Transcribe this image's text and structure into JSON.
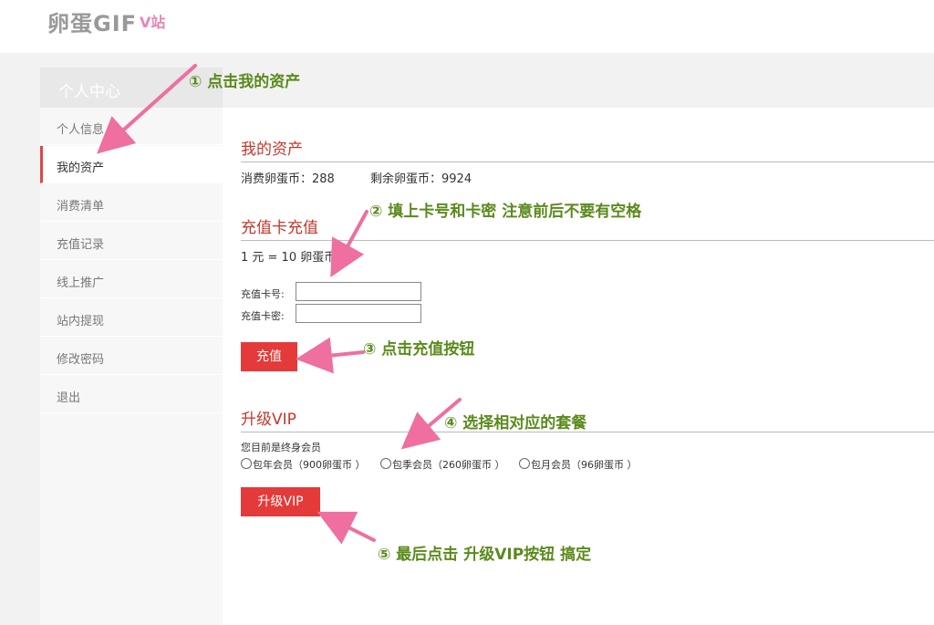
{
  "header": {
    "logo": "卵蛋GIF",
    "logo_sub": "V站"
  },
  "sidebar": {
    "title": "个人中心",
    "items": [
      {
        "label": "个人信息"
      },
      {
        "label": "我的资产"
      },
      {
        "label": "消费清单"
      },
      {
        "label": "充值记录"
      },
      {
        "label": "线上推广"
      },
      {
        "label": "站内提现"
      },
      {
        "label": "修改密码"
      },
      {
        "label": "退出"
      }
    ],
    "active_index": 1
  },
  "assets": {
    "title": "我的资产",
    "spent": "消费卵蛋币：288",
    "remaining": "剩余卵蛋币：9924"
  },
  "recharge": {
    "title": "充值卡充值",
    "rate": "1 元 = 10 卵蛋币",
    "card_no_label": "充值卡号:",
    "card_pwd_label": "充值卡密:",
    "card_no_value": "",
    "card_pwd_value": "",
    "button": "充值"
  },
  "vip": {
    "title": "升级VIP",
    "status": "您目前是终身会员",
    "options": [
      {
        "label": "包年会员（900卵蛋币 ）"
      },
      {
        "label": "包季会员（260卵蛋币 ）"
      },
      {
        "label": "包月会员（96卵蛋币 ）"
      }
    ],
    "button": "升级VIP"
  },
  "annotations": {
    "step1": "① 点击我的资产",
    "step2": "② 填上卡号和卡密 注意前后不要有空格",
    "step3": "③ 点击充值按钮",
    "step4": "④ 选择相对应的套餐",
    "step5": "⑤ 最后点击 升级VIP按钮 搞定",
    "arrow_color": "#ee6fa0",
    "text_color": "#5a8a1c"
  },
  "colors": {
    "accent": "#e53a3a",
    "section_title": "#c0392b"
  }
}
